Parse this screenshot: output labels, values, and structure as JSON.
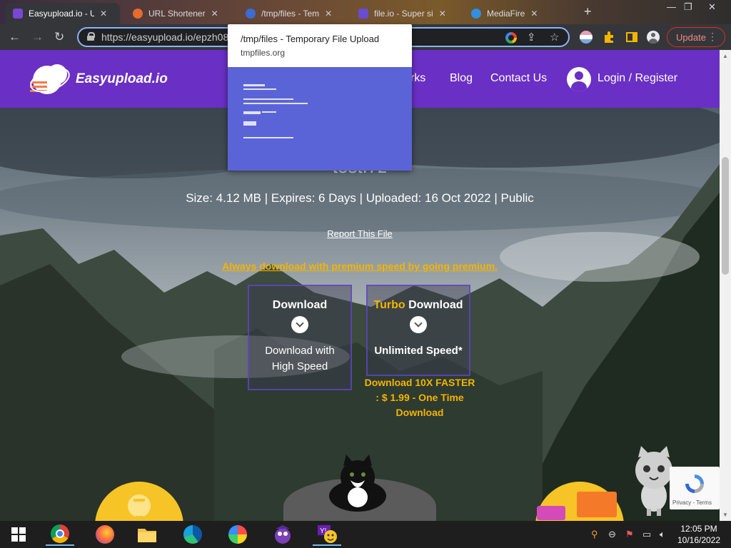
{
  "browser": {
    "tabs": [
      {
        "title": "Easyupload.io - U",
        "active": true
      },
      {
        "title": "URL Shortener",
        "active": false
      },
      {
        "title": "/tmp/files - Tem",
        "active": false
      },
      {
        "title": "file.io - Super si",
        "active": false
      },
      {
        "title": "MediaFire",
        "active": false
      }
    ],
    "new_tab_label": "+",
    "url": "https://easyupload.io/epzh08",
    "update_label": "Update"
  },
  "hovercard": {
    "title": "/tmp/files - Temporary File Upload",
    "domain": "tmpfiles.org"
  },
  "site": {
    "logo_text": "Easyupload.io",
    "nav": {
      "works": "orks",
      "blog": "Blog",
      "contact": "Contact Us",
      "login": "Login / Register"
    }
  },
  "file": {
    "title": "test.7z",
    "meta": "Size: 4.12 MB | Expires: 6 Days | Uploaded: 16 Oct 2022 | Public",
    "report": "Report This File",
    "premium_promo": "Always download with premium speed by going premium."
  },
  "download_free": {
    "heading": "Download",
    "subtitle_line1": "Download with",
    "subtitle_line2": "High Speed"
  },
  "download_turbo": {
    "heading_accent": "Turbo",
    "heading_rest": " Download",
    "subtitle": "Unlimited Speed*",
    "offer_line1": "Download 10X FASTER",
    "offer_line2": ": $ 1.99 - One Time",
    "offer_line3": "Download"
  },
  "recaptcha": {
    "links": "Privacy - Terms"
  },
  "taskbar": {
    "apps": [
      "windows-start",
      "chrome",
      "firefox",
      "file-explorer",
      "edge",
      "chromium",
      "bonzi",
      "yahoo-messenger"
    ],
    "time": "12:05 PM",
    "date": "10/16/2022"
  },
  "colors": {
    "brand_purple": "#6a2fc4",
    "accent_gold": "#f4b400",
    "update_red": "#d93025"
  }
}
